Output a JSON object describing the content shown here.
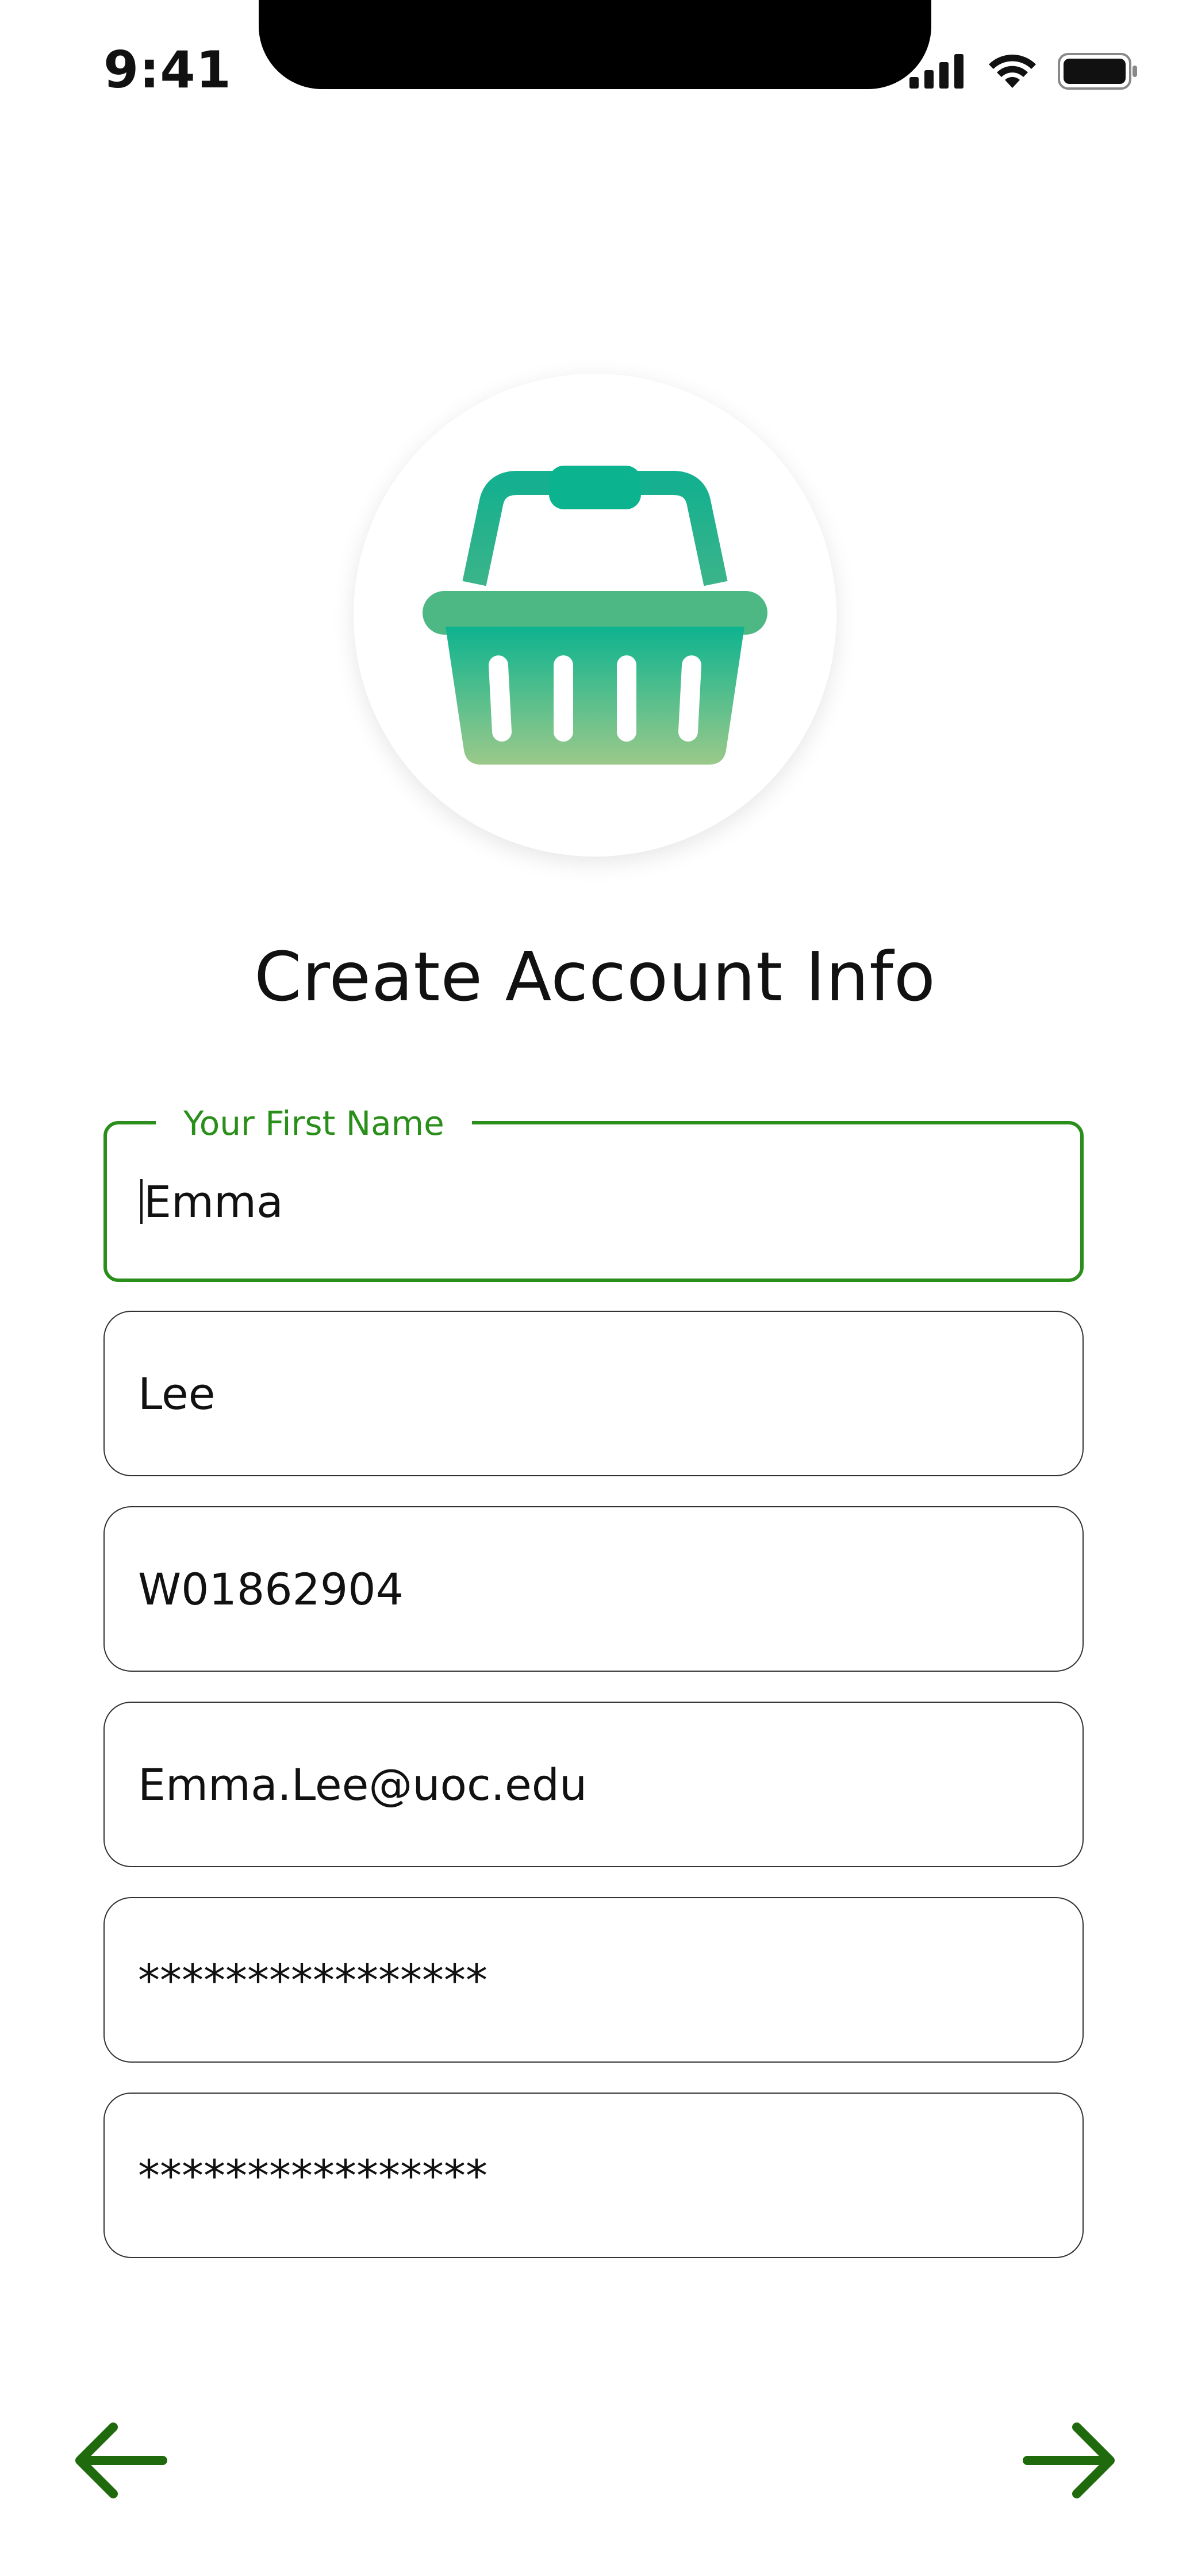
{
  "status_bar": {
    "time": "9:41"
  },
  "page": {
    "title": "Create Account Info"
  },
  "form": {
    "first_name": {
      "label": "Your First Name",
      "value": "Emma"
    },
    "last_name": {
      "value": "Lee"
    },
    "student_id": {
      "value": "W01862904"
    },
    "email": {
      "value": "Emma.Lee@uoc.edu"
    },
    "password": {
      "value": "****************"
    },
    "confirm_password": {
      "value": "****************"
    }
  },
  "colors": {
    "accent": "#2a8f1a",
    "arrow": "#1f6a0c",
    "basket_top": "#0db38f",
    "basket_bottom": "#9bc98a"
  },
  "icons": {
    "logo": "shopping-basket-icon",
    "back": "arrow-left-icon",
    "next": "arrow-right-icon"
  }
}
